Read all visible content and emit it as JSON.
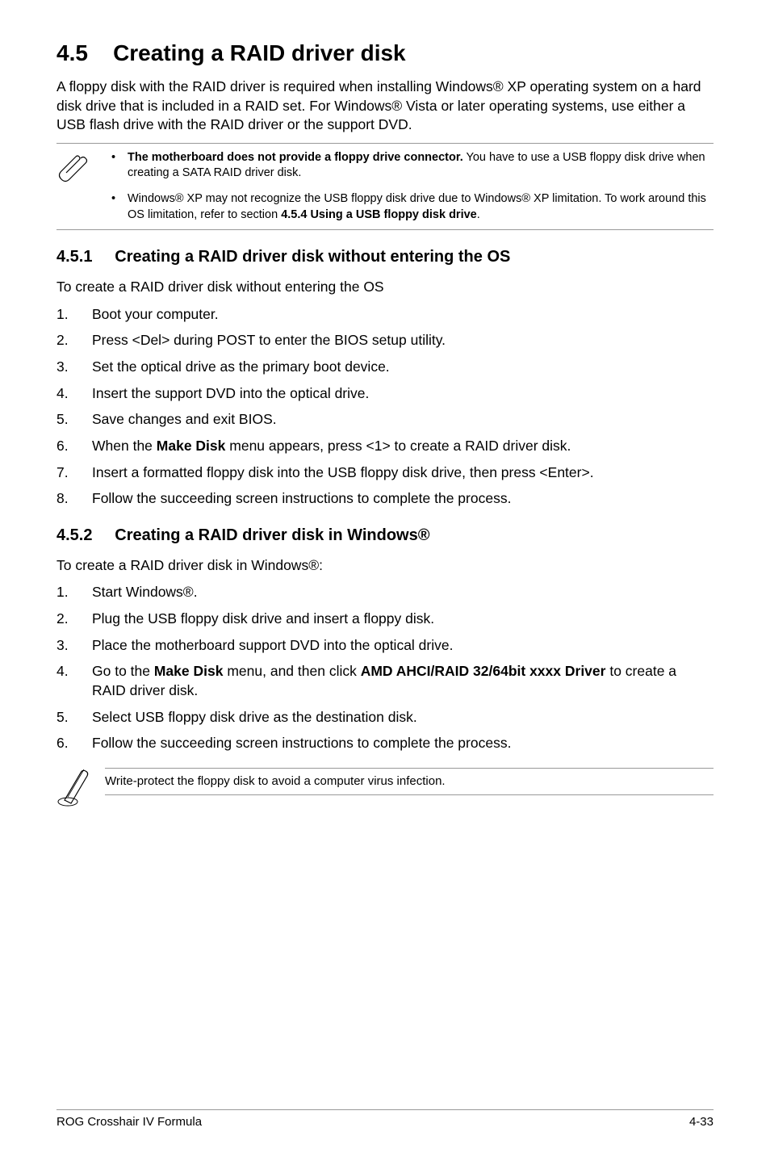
{
  "section": {
    "number": "4.5",
    "title": "Creating a RAID driver disk",
    "intro": "A floppy disk with the RAID driver is required when installing Windows® XP operating system on a hard disk drive that is included in a RAID set. For Windows® Vista or later operating systems, use either a USB flash drive with the RAID driver or the support DVD."
  },
  "top_notes": {
    "bullet1_bold": "The motherboard does not provide a floppy drive connector.",
    "bullet1_rest": " You have to use a USB floppy disk drive when creating a SATA RAID driver disk.",
    "bullet2_part1": "Windows® XP may not recognize the USB floppy disk drive due to Windows® XP limitation. To work around this OS limitation, refer to section ",
    "bullet2_bold": "4.5.4 Using a USB floppy disk drive",
    "bullet2_end": "."
  },
  "sub1": {
    "number": "4.5.1",
    "title": "Creating a RAID driver disk without entering the OS",
    "lead": "To create a RAID driver disk without entering the OS",
    "steps": {
      "1": "Boot your computer.",
      "2": "Press <Del> during POST to enter the BIOS setup utility.",
      "3": "Set the optical drive as the primary boot device.",
      "4": "Insert the support DVD into the optical drive.",
      "5": "Save changes and exit BIOS.",
      "6_pre": "When the ",
      "6_bold": "Make Disk",
      "6_post": " menu appears, press <1> to create a RAID driver disk.",
      "7": "Insert a formatted floppy disk into the USB floppy disk drive, then press <Enter>.",
      "8": "Follow the succeeding screen instructions to complete the process."
    }
  },
  "sub2": {
    "number": "4.5.2",
    "title": "Creating a RAID driver disk in Windows®",
    "lead": "To create a RAID driver disk in Windows®:",
    "steps": {
      "1": "Start Windows®.",
      "2": "Plug the USB floppy disk drive and insert a floppy disk.",
      "3": "Place the motherboard support DVD into the optical drive.",
      "4_pre": "Go to the ",
      "4_bold1": "Make Disk",
      "4_mid": " menu, and then click ",
      "4_bold2": "AMD AHCI/RAID 32/64bit xxxx Driver",
      "4_post": " to create a RAID driver disk.",
      "5": "Select USB floppy disk drive as the destination disk.",
      "6": "Follow the succeeding screen instructions to complete the process."
    }
  },
  "bottom_note": "Write-protect the floppy disk to avoid a computer virus infection.",
  "footer": {
    "left": "ROG Crosshair IV Formula",
    "right": "4-33"
  }
}
